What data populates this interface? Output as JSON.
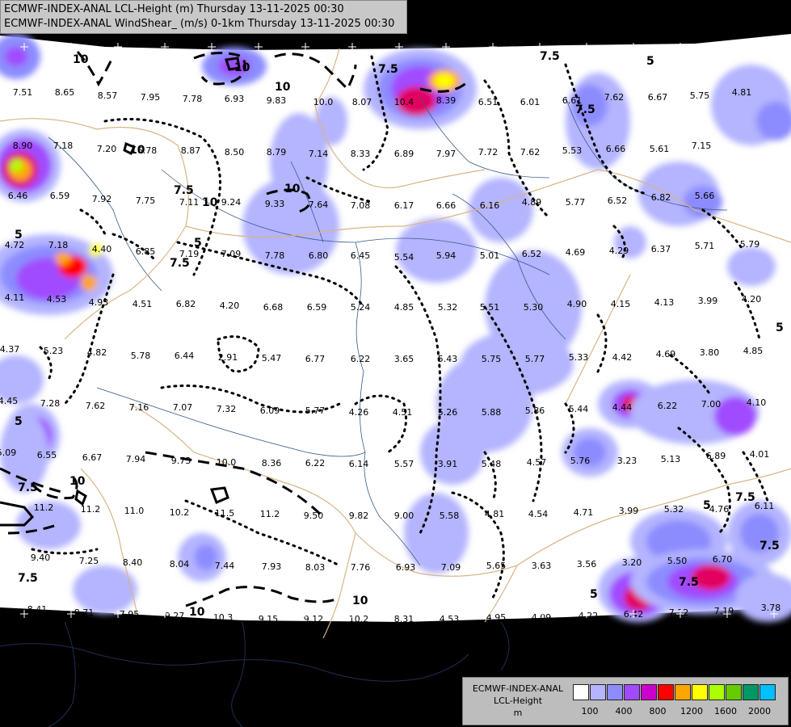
{
  "header": {
    "line1": "ECMWF-INDEX-ANAL LCL-Height (m) Thursday 13-11-2025 00:30",
    "line2": "ECMWF-INDEX-ANAL WindShear_ (m/s) 0-1km Thursday 13-11-2025 00:30"
  },
  "legend": {
    "line1": "ECMWF-INDEX-ANAL",
    "line2": "LCL-Height",
    "line3": "m",
    "colors": [
      "#ffffff",
      "#b4b4ff",
      "#8c8cff",
      "#a04bff",
      "#cc00cc",
      "#e20060",
      "#ff0000",
      "#ffa500",
      "#ffff00",
      "#aaff00",
      "#66cc00",
      "#009966",
      "#00bfff"
    ],
    "ticks": [
      "100",
      "400",
      "800",
      "1200",
      "1600",
      "2000"
    ]
  },
  "contour_labels": [
    "10",
    "10",
    "7.5",
    "7.5",
    "10",
    "7.5",
    "10",
    "7.5",
    "5",
    "10",
    "7.5",
    "5",
    "5",
    "7.5",
    "10",
    "10",
    "5",
    "7.5",
    "7.5",
    "7.5",
    "5",
    "7.5",
    "10",
    "10",
    "5",
    "5"
  ],
  "windshear_values": [
    "7.51",
    "8.65",
    "8.57",
    "7.95",
    "7.78",
    "6.93",
    "9.83",
    "10.0",
    "8.07",
    "10.4",
    "8.39",
    "6.51",
    "6.01",
    "6.61",
    "7.62",
    "6.67",
    "5.75",
    "4.81",
    "8.90",
    "7.18",
    "7.20",
    "6.78",
    "8.87",
    "8.50",
    "8.79",
    "7.14",
    "8.33",
    "6.89",
    "7.97",
    "7.72",
    "7.62",
    "5.53",
    "6.66",
    "5.61",
    "7.15",
    "6.46",
    "6.59",
    "7.92",
    "7.75",
    "7.11",
    "9.24",
    "9.33",
    "7.64",
    "7.08",
    "6.17",
    "6.66",
    "6.16",
    "4.89",
    "5.77",
    "6.52",
    "6.82",
    "5.66",
    "4.72",
    "7.18",
    "4.40",
    "6.85",
    "7.19",
    "7.09",
    "7.78",
    "6.80",
    "6.45",
    "5.54",
    "5.94",
    "5.01",
    "6.52",
    "4.69",
    "4.29",
    "6.37",
    "5.71",
    "5.79",
    "4.11",
    "4.53",
    "4.93",
    "4.51",
    "6.82",
    "4.20",
    "6.68",
    "6.59",
    "5.24",
    "4.85",
    "5.32",
    "5.51",
    "5.30",
    "4.90",
    "4.15",
    "4.13",
    "3.99",
    "4.20",
    "4.37",
    "5.23",
    "4.82",
    "5.78",
    "6.44",
    "2.91",
    "5.47",
    "6.77",
    "6.22",
    "3.65",
    "5.43",
    "5.75",
    "5.77",
    "5.33",
    "4.42",
    "4.69",
    "3.80",
    "4.85",
    "4.45",
    "7.28",
    "7.62",
    "7.16",
    "7.07",
    "7.32",
    "6.09",
    "5.77",
    "4.26",
    "4.51",
    "5.26",
    "5.88",
    "5.86",
    "5.44",
    "4.44",
    "6.22",
    "7.00",
    "4.10",
    "5.09",
    "6.55",
    "6.67",
    "7.94",
    "9.73",
    "10.0",
    "8.36",
    "6.22",
    "6.14",
    "5.57",
    "3.91",
    "5.48",
    "4.57",
    "5.76",
    "3.23",
    "5.13",
    "6.89",
    "4.01",
    "11.2",
    "11.2",
    "11.0",
    "10.2",
    "11.5",
    "11.2",
    "9.50",
    "9.82",
    "9.00",
    "5.58",
    "4.81",
    "4.54",
    "4.71",
    "3.99",
    "5.32",
    "4.76",
    "6.11",
    "9.40",
    "7.25",
    "8.40",
    "8.04",
    "7.44",
    "7.93",
    "8.03",
    "7.76",
    "6.93",
    "7.09",
    "5.65",
    "3.63",
    "3.56",
    "3.20",
    "5.50",
    "6.70",
    "8.41",
    "8.71",
    "7.95",
    "9.27",
    "10.3",
    "9.15",
    "9.12",
    "10.2",
    "8.31",
    "4.53",
    "4.95",
    "4.09",
    "4.22",
    "6.42",
    "7.12",
    "7.19",
    "3.78"
  ]
}
